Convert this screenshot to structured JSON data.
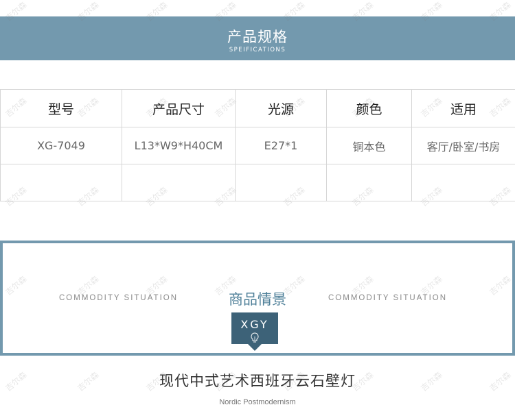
{
  "header": {
    "title": "产品规格",
    "subtitle": "SPEIFICATIONS"
  },
  "spec_table": {
    "columns": [
      "型号",
      "产品尺寸",
      "光源",
      "颜色",
      "适用"
    ],
    "rows": [
      [
        "XG-7049",
        "L13*W9*H40CM",
        "E27*1",
        "铜本色",
        "客厅/卧室/书房"
      ]
    ]
  },
  "scene": {
    "label_left": "COMMODITY SITUATION",
    "label_center": "商品情景",
    "label_right": "COMMODITY SITUATION",
    "badge": "XGY",
    "badge_icon": "light-bulb-icon"
  },
  "product": {
    "title": "现代中式艺术西班牙云石壁灯",
    "subtitle": "Nordic Postmodernism"
  },
  "watermark": "吉尔森",
  "colors": {
    "banner": "#7399ae",
    "frame": "#7399ae",
    "badge": "#3d6278",
    "accent_text": "#4e7f98"
  }
}
